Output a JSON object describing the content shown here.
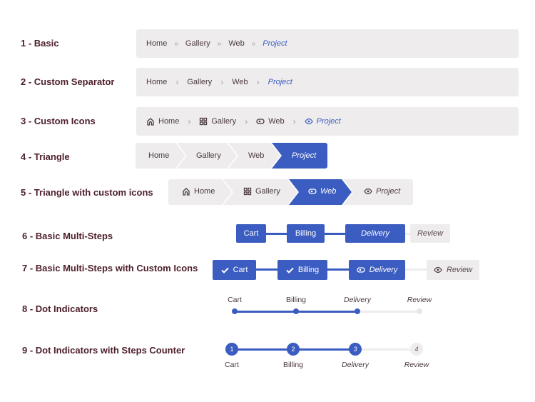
{
  "colors": {
    "accent": "#3b5cc0",
    "muted_bg": "#eeecec",
    "label": "#4d1f2a",
    "text": "#4a3a3f"
  },
  "sections": [
    {
      "label": "1 - Basic"
    },
    {
      "label": "2 - Custom Separator"
    },
    {
      "label": "3 - Custom Icons"
    },
    {
      "label": "4 - Triangle"
    },
    {
      "label": "5 - Triangle with custom icons"
    },
    {
      "label": "6 - Basic Multi-Steps"
    },
    {
      "label": "7 - Basic Multi-Steps with Custom Icons"
    },
    {
      "label": "8 - Dot Indicators"
    },
    {
      "label": "9 - Dot Indicators with Steps Counter"
    }
  ],
  "breadcrumb": {
    "items": [
      "Home",
      "Gallery",
      "Web",
      "Project"
    ],
    "separator_basic": "»",
    "separator_custom": "›",
    "icons": [
      "home-icon",
      "grid-icon",
      "toggle-icon",
      "eye-icon"
    ]
  },
  "steps": {
    "items": [
      "Cart",
      "Billing",
      "Delivery",
      "Review"
    ],
    "counters": [
      "1",
      "2",
      "3",
      "4"
    ],
    "current_step": 3,
    "icons": [
      "check-icon",
      "check-icon",
      "toggle-icon",
      "eye-icon"
    ]
  }
}
